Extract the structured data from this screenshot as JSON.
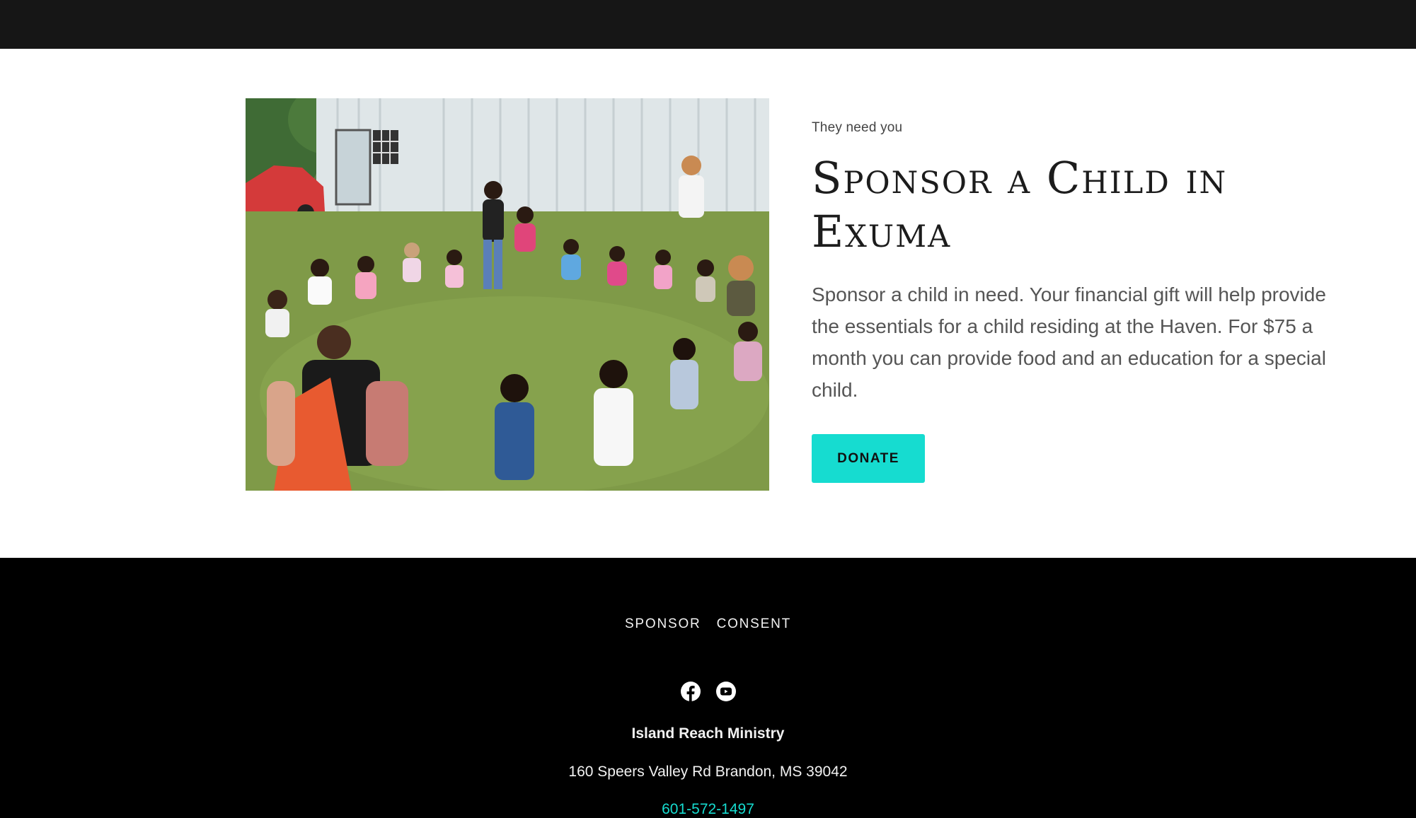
{
  "hero": {
    "eyebrow": "They need you",
    "title": "Sponsor a Child in Exuma",
    "description": " Sponsor a child in need. Your financial gift will help provide the essentials for a child residing at the Haven. For $75 a month you can provide food and an education for a special child.",
    "donate_label": "DONATE"
  },
  "footer": {
    "nav": [
      {
        "label": "SPONSOR"
      },
      {
        "label": "CONSENT"
      }
    ],
    "socials": [
      {
        "icon": "facebook-icon"
      },
      {
        "icon": "youtube-icon"
      }
    ],
    "org_name": "Island Reach Ministry",
    "address": "160 Speers Valley Rd Brandon, MS 39042",
    "phone": "601-572-1497"
  },
  "colors": {
    "accent": "#16dcd0",
    "top_bar": "#161616",
    "footer_bg": "#000000"
  }
}
